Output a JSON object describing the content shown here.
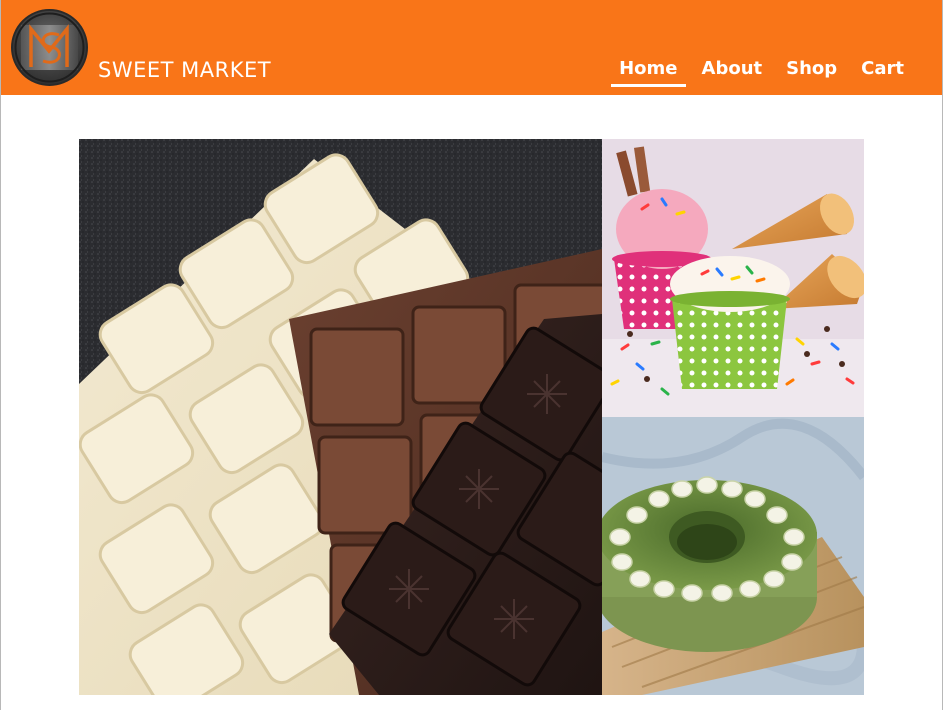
{
  "header": {
    "brand_name": "SWEET MARKET",
    "logo_icon": "sm-monogram-logo-icon",
    "background_color": "#f97518"
  },
  "nav": {
    "items": [
      {
        "label": "Home",
        "active": true
      },
      {
        "label": "About",
        "active": false
      },
      {
        "label": "Shop",
        "active": false
      },
      {
        "label": "Cart",
        "active": false
      }
    ]
  },
  "gallery": {
    "images": [
      {
        "subject": "chocolate bars (white, milk, dark)"
      },
      {
        "subject": "ice cream cups and cones with sprinkles"
      },
      {
        "subject": "matcha bundt cake on wooden board"
      }
    ]
  }
}
